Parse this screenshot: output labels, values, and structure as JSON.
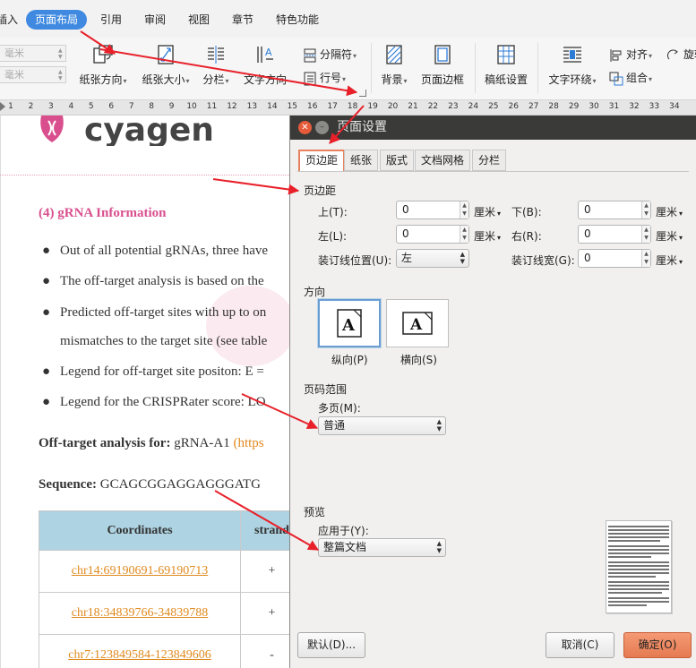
{
  "menu": {
    "items": [
      {
        "label": "插入",
        "active": false
      },
      {
        "label": "页面布局",
        "active": true
      },
      {
        "label": "引用",
        "active": false
      },
      {
        "label": "审阅",
        "active": false
      },
      {
        "label": "视图",
        "active": false
      },
      {
        "label": "章节",
        "active": false
      },
      {
        "label": "特色功能",
        "active": false
      }
    ]
  },
  "ribbon": {
    "field1": "毫米",
    "field2": "毫米",
    "paper_orientation": "纸张方向",
    "paper_size": "纸张大小",
    "columns": "分栏",
    "text_direction": "文字方向",
    "separator": "分隔符",
    "line_number": "行号",
    "background": "背景",
    "page_border": "页面边框",
    "draft_paper": "稿纸设置",
    "text_wrap": "文字环绕",
    "align": "对齐",
    "group": "组合",
    "rotate": "旋转"
  },
  "ruler": {
    "numbers": [
      "1",
      "2",
      "3",
      "4",
      "5",
      "6",
      "7",
      "8",
      "9",
      "10",
      "11",
      "12",
      "13",
      "14",
      "15",
      "16",
      "17",
      "18",
      "19",
      "20",
      "21",
      "22",
      "23",
      "24",
      "25",
      "26",
      "27",
      "28",
      "29",
      "30",
      "31",
      "32",
      "33",
      "34"
    ]
  },
  "doc": {
    "logo_text": "cyagen",
    "heading": "(4) gRNA Information",
    "bullets": [
      "Out of all potential gRNAs, three have",
      "The off-target analysis is based on the",
      "Predicted off-target sites with up to on",
      "mismatches to the target site (see table",
      "Legend for off-target site positon: E =",
      "Legend for the CRISPRater score: LO"
    ],
    "offtarget_label": "Off-target analysis for:",
    "offtarget_value": "gRNA-A1",
    "offtarget_link": "(https",
    "sequence_label": "Sequence:",
    "sequence_value": "GCAGCGGAGGAGGGATG",
    "table": {
      "headers": [
        "Coordinates",
        "strand"
      ],
      "rows": [
        {
          "coord": "chr14:69190691-69190713",
          "strand": "+"
        },
        {
          "coord": "chr18:34839766-34839788",
          "strand": "+"
        },
        {
          "coord": "chr7:123849584-123849606",
          "strand": "-"
        }
      ]
    }
  },
  "dialog": {
    "title": "页面设置",
    "tabs": [
      {
        "label": "页边距",
        "active": true
      },
      {
        "label": "纸张",
        "active": false
      },
      {
        "label": "版式",
        "active": false
      },
      {
        "label": "文档网格",
        "active": false
      },
      {
        "label": "分栏",
        "active": false
      }
    ],
    "margins": {
      "section": "页边距",
      "top_label": "上(T):",
      "top_value": "0",
      "bottom_label": "下(B):",
      "bottom_value": "0",
      "left_label": "左(L):",
      "left_value": "0",
      "right_label": "右(R):",
      "right_value": "0",
      "gutter_pos_label": "装订线位置(U):",
      "gutter_pos_value": "左",
      "gutter_width_label": "装订线宽(G):",
      "gutter_width_value": "0",
      "unit": "厘米"
    },
    "orientation": {
      "section": "方向",
      "portrait": "纵向(P)",
      "landscape": "横向(S)",
      "selected": "portrait"
    },
    "page_range": {
      "section": "页码范围",
      "multi_label": "多页(M):",
      "multi_value": "普通"
    },
    "preview": {
      "section": "预览",
      "apply_label": "应用于(Y):",
      "apply_value": "整篇文档"
    },
    "buttons": {
      "default": "默认(D)...",
      "cancel": "取消(C)",
      "ok": "确定(O)"
    }
  },
  "colors": {
    "accent": "#3f8ae0",
    "annotation": "#e8202a",
    "heading_pink": "#d94f8e",
    "link_orange": "#e08a20",
    "ok_button": "#e57a52"
  }
}
